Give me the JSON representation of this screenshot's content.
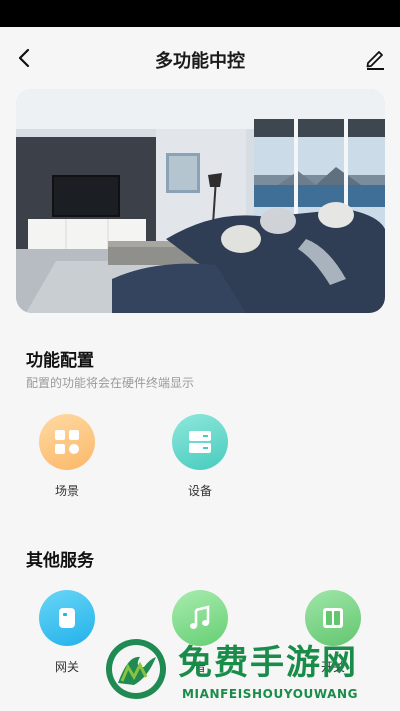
{
  "header": {
    "title": "多功能中控"
  },
  "function_config": {
    "title": "功能配置",
    "subtitle": "配置的功能将会在硬件终端显示",
    "items": [
      {
        "label": "场景",
        "icon": "grid-scene-icon",
        "color": "#fbb868"
      },
      {
        "label": "设备",
        "icon": "device-cabinet-icon",
        "color": "#47ccbd"
      }
    ]
  },
  "other_services": {
    "title": "其他服务",
    "items": [
      {
        "label": "网关",
        "icon": "gateway-icon",
        "color": "#23b1ea"
      },
      {
        "label": "音",
        "icon": "music-note-icon",
        "color": "#66cf74"
      },
      {
        "label": "开关",
        "icon": "switch-panel-icon",
        "color": "#62c66f"
      }
    ]
  },
  "watermark": {
    "text": "免费手游网",
    "pinyin": "MIANFEISHOUYOUWANG"
  }
}
